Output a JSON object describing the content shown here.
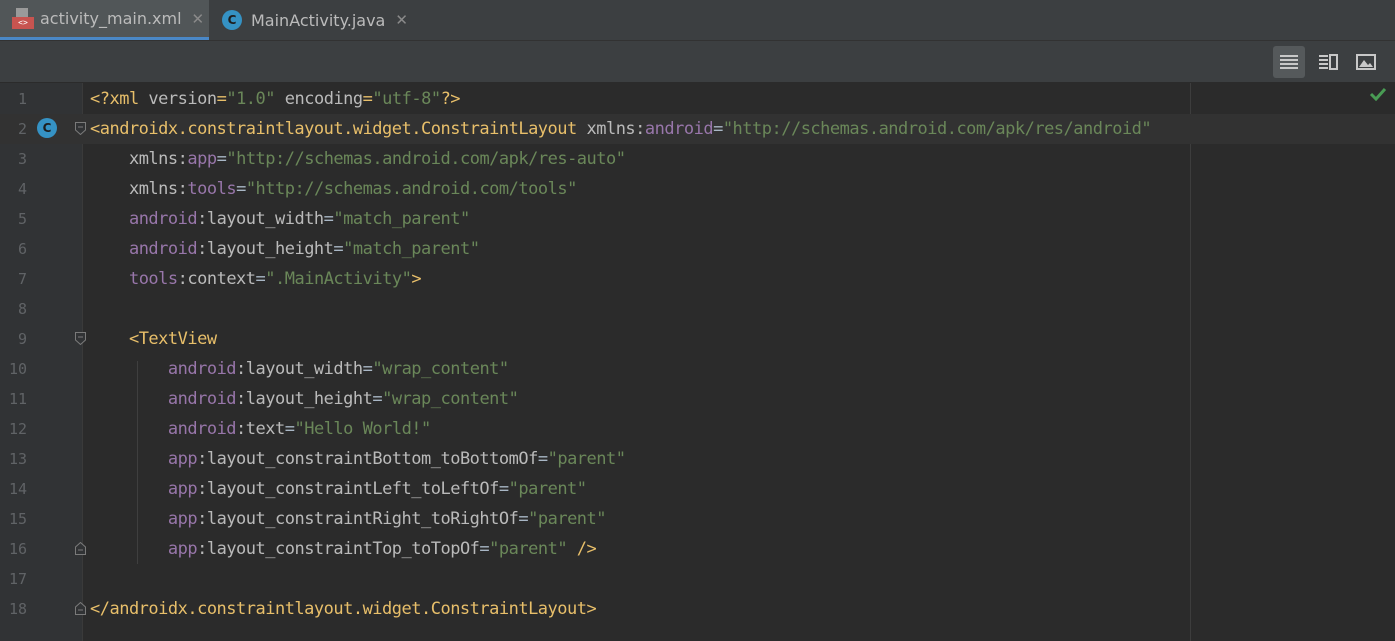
{
  "tabs": [
    {
      "label": "activity_main.xml",
      "icon": "xml-file-icon",
      "badge": "<>",
      "active": true
    },
    {
      "label": "MainActivity.java",
      "icon": "java-class-icon",
      "badge": "C",
      "active": false
    }
  ],
  "tab_close_glyph": "✕",
  "toolbar": {
    "buttons": [
      "code-view-icon",
      "split-view-icon",
      "design-view-icon"
    ],
    "active": "code-view-icon"
  },
  "gutter_class_badge": "C",
  "status": {
    "inspection": "check-icon",
    "color": "#499c54"
  },
  "colors": {
    "tag": "#e8bf6a",
    "attribute": "#bababa",
    "namespace": "#9876aa",
    "value": "#6a8759",
    "plain": "#a9b7c6",
    "line_number": "#606366",
    "background": "#2b2b2b",
    "gutter": "#313335"
  },
  "editor": {
    "lines": [
      {
        "n": "1",
        "tokens": [
          [
            "tg",
            "<?xml "
          ],
          [
            "at",
            "version"
          ],
          [
            "tg",
            "="
          ],
          [
            "vl",
            "\"1.0\""
          ],
          [
            "tg",
            " "
          ],
          [
            "at",
            "encoding"
          ],
          [
            "tg",
            "="
          ],
          [
            "vl",
            "\"utf-8\""
          ],
          [
            "tg",
            "?>"
          ]
        ]
      },
      {
        "n": "2",
        "tokens": [
          [
            "tg",
            "<androidx.constraintlayout.widget.ConstraintLayout "
          ],
          [
            "at",
            "xmlns:"
          ],
          [
            "ns",
            "android"
          ],
          [
            "pl",
            "="
          ],
          [
            "vl",
            "\"http://schemas.android.com/apk/res/android\""
          ]
        ]
      },
      {
        "n": "3",
        "tokens": [
          [
            "pl",
            "    "
          ],
          [
            "at",
            "xmlns:"
          ],
          [
            "ns",
            "app"
          ],
          [
            "pl",
            "="
          ],
          [
            "vl",
            "\"http://schemas.android.com/apk/res-auto\""
          ]
        ]
      },
      {
        "n": "4",
        "tokens": [
          [
            "pl",
            "    "
          ],
          [
            "at",
            "xmlns:"
          ],
          [
            "ns",
            "tools"
          ],
          [
            "pl",
            "="
          ],
          [
            "vl",
            "\"http://schemas.android.com/tools\""
          ]
        ]
      },
      {
        "n": "5",
        "tokens": [
          [
            "pl",
            "    "
          ],
          [
            "ns",
            "android"
          ],
          [
            "at",
            ":layout_width"
          ],
          [
            "pl",
            "="
          ],
          [
            "vl",
            "\"match_parent\""
          ]
        ]
      },
      {
        "n": "6",
        "tokens": [
          [
            "pl",
            "    "
          ],
          [
            "ns",
            "android"
          ],
          [
            "at",
            ":layout_height"
          ],
          [
            "pl",
            "="
          ],
          [
            "vl",
            "\"match_parent\""
          ]
        ]
      },
      {
        "n": "7",
        "tokens": [
          [
            "pl",
            "    "
          ],
          [
            "ns",
            "tools"
          ],
          [
            "at",
            ":context"
          ],
          [
            "pl",
            "="
          ],
          [
            "vl",
            "\".MainActivity\""
          ],
          [
            "tg",
            ">"
          ]
        ]
      },
      {
        "n": "8",
        "tokens": []
      },
      {
        "n": "9",
        "tokens": [
          [
            "pl",
            "    "
          ],
          [
            "tg",
            "<TextView"
          ]
        ]
      },
      {
        "n": "10",
        "tokens": [
          [
            "pl",
            "        "
          ],
          [
            "ns",
            "android"
          ],
          [
            "at",
            ":layout_width"
          ],
          [
            "pl",
            "="
          ],
          [
            "vl",
            "\"wrap_content\""
          ]
        ]
      },
      {
        "n": "11",
        "tokens": [
          [
            "pl",
            "        "
          ],
          [
            "ns",
            "android"
          ],
          [
            "at",
            ":layout_height"
          ],
          [
            "pl",
            "="
          ],
          [
            "vl",
            "\"wrap_content\""
          ]
        ]
      },
      {
        "n": "12",
        "tokens": [
          [
            "pl",
            "        "
          ],
          [
            "ns",
            "android"
          ],
          [
            "at",
            ":text"
          ],
          [
            "pl",
            "="
          ],
          [
            "vl",
            "\"Hello World!\""
          ]
        ]
      },
      {
        "n": "13",
        "tokens": [
          [
            "pl",
            "        "
          ],
          [
            "ns",
            "app"
          ],
          [
            "at",
            ":layout_constraintBottom_toBottomOf"
          ],
          [
            "pl",
            "="
          ],
          [
            "vl",
            "\"parent\""
          ]
        ]
      },
      {
        "n": "14",
        "tokens": [
          [
            "pl",
            "        "
          ],
          [
            "ns",
            "app"
          ],
          [
            "at",
            ":layout_constraintLeft_toLeftOf"
          ],
          [
            "pl",
            "="
          ],
          [
            "vl",
            "\"parent\""
          ]
        ]
      },
      {
        "n": "15",
        "tokens": [
          [
            "pl",
            "        "
          ],
          [
            "ns",
            "app"
          ],
          [
            "at",
            ":layout_constraintRight_toRightOf"
          ],
          [
            "pl",
            "="
          ],
          [
            "vl",
            "\"parent\""
          ]
        ]
      },
      {
        "n": "16",
        "tokens": [
          [
            "pl",
            "        "
          ],
          [
            "ns",
            "app"
          ],
          [
            "at",
            ":layout_constraintTop_toTopOf"
          ],
          [
            "pl",
            "="
          ],
          [
            "vl",
            "\"parent\""
          ],
          [
            "tg",
            " />"
          ]
        ]
      },
      {
        "n": "17",
        "tokens": []
      },
      {
        "n": "18",
        "tokens": [
          [
            "tg",
            "</androidx.constraintlayout.widget.ConstraintLayout>"
          ]
        ]
      }
    ]
  }
}
